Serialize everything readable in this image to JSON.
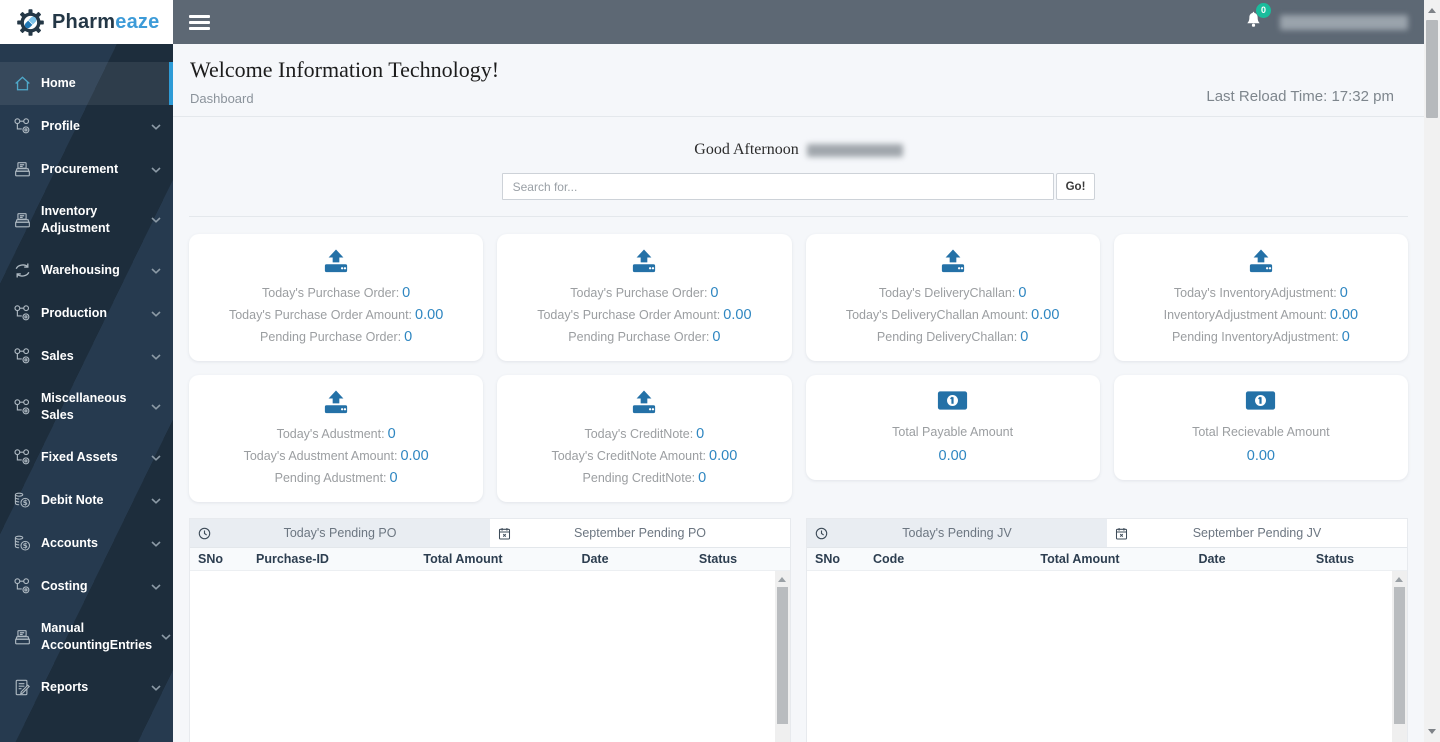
{
  "brand": {
    "name": "Pharmeaze",
    "name_primary": "Pharm",
    "name_accent": "eaze"
  },
  "header": {
    "notification_count": "0"
  },
  "sidebar": {
    "items": [
      {
        "label": "Home",
        "icon": "house-icon",
        "active": true
      },
      {
        "label": "Profile",
        "icon": "workflow-icon"
      },
      {
        "label": "Procurement",
        "icon": "register-icon"
      },
      {
        "label": "Inventory Adjustment",
        "icon": "register-icon"
      },
      {
        "label": "Warehousing",
        "icon": "sync-icon"
      },
      {
        "label": "Production",
        "icon": "workflow-icon"
      },
      {
        "label": "Sales",
        "icon": "workflow-icon"
      },
      {
        "label": "Miscellaneous Sales",
        "icon": "workflow-icon"
      },
      {
        "label": "Fixed Assets",
        "icon": "workflow-icon"
      },
      {
        "label": "Debit Note",
        "icon": "coins-icon"
      },
      {
        "label": "Accounts",
        "icon": "coins-icon"
      },
      {
        "label": "Costing",
        "icon": "workflow-icon"
      },
      {
        "label": "Manual AccountingEntries",
        "icon": "register-icon"
      },
      {
        "label": "Reports",
        "icon": "report-icon"
      }
    ]
  },
  "page": {
    "welcome_title": "Welcome Information Technology!",
    "breadcrumb": "Dashboard",
    "last_reload_label": "Last Reload Time:",
    "last_reload_time": "17:32 pm",
    "greeting": "Good Afternoon"
  },
  "search": {
    "placeholder": "Search for...",
    "go_label": "Go!"
  },
  "stat_cards": [
    {
      "icon": "upload-icon",
      "lines": [
        {
          "label": "Today's Purchase Order:",
          "value": "0"
        },
        {
          "label": "Today's Purchase Order Amount:",
          "value": "0.00"
        },
        {
          "label": "Pending Purchase Order:",
          "value": "0"
        }
      ]
    },
    {
      "icon": "upload-icon",
      "lines": [
        {
          "label": "Today's Purchase Order:",
          "value": "0"
        },
        {
          "label": "Today's Purchase Order Amount:",
          "value": "0.00"
        },
        {
          "label": "Pending Purchase Order:",
          "value": "0"
        }
      ]
    },
    {
      "icon": "upload-icon",
      "lines": [
        {
          "label": "Today's DeliveryChallan:",
          "value": "0"
        },
        {
          "label": "Today's DeliveryChallan Amount:",
          "value": "0.00"
        },
        {
          "label": "Pending DeliveryChallan:",
          "value": "0"
        }
      ]
    },
    {
      "icon": "upload-icon",
      "lines": [
        {
          "label": "Today's InventoryAdjustment:",
          "value": "0"
        },
        {
          "label": "InventoryAdjustment Amount:",
          "value": "0.00"
        },
        {
          "label": "Pending InventoryAdjustment:",
          "value": "0"
        }
      ]
    },
    {
      "icon": "upload-icon",
      "lines": [
        {
          "label": "Today's Adustment:",
          "value": "0"
        },
        {
          "label": "Today's Adustment Amount:",
          "value": "0.00"
        },
        {
          "label": "Pending Adustment:",
          "value": "0"
        }
      ]
    },
    {
      "icon": "upload-icon",
      "lines": [
        {
          "label": "Today's CreditNote:",
          "value": "0"
        },
        {
          "label": "Today's CreditNote Amount:",
          "value": "0.00"
        },
        {
          "label": "Pending CreditNote:",
          "value": "0"
        }
      ]
    },
    {
      "icon": "money-icon",
      "title": "Total Payable Amount",
      "value": "0.00"
    },
    {
      "icon": "money-icon",
      "title": "Total Recievable Amount",
      "value": "0.00"
    }
  ],
  "tables": [
    {
      "tabs": [
        {
          "label": "Today's Pending PO",
          "icon": "clock-icon",
          "active": true
        },
        {
          "label": "September Pending PO",
          "icon": "calendar-icon",
          "active": false
        }
      ],
      "columns": [
        "SNo",
        "Purchase-ID",
        "Total Amount",
        "Date",
        "Status"
      ],
      "rows": []
    },
    {
      "tabs": [
        {
          "label": "Today's Pending JV",
          "icon": "clock-icon",
          "active": true
        },
        {
          "label": "September Pending JV",
          "icon": "calendar-icon",
          "active": false
        }
      ],
      "columns": [
        "SNo",
        "Code",
        "Total Amount",
        "Date",
        "Status"
      ],
      "rows": []
    }
  ],
  "colors": {
    "sidebar_bg": "#1e2e3e",
    "topbar_bg": "#5d6874",
    "accent_blue": "#2e9bd6",
    "value_blue": "#2e86c1",
    "icon_blue": "#2471a7",
    "badge_green": "#1abc9c",
    "main_bg": "#f5f7fa"
  }
}
